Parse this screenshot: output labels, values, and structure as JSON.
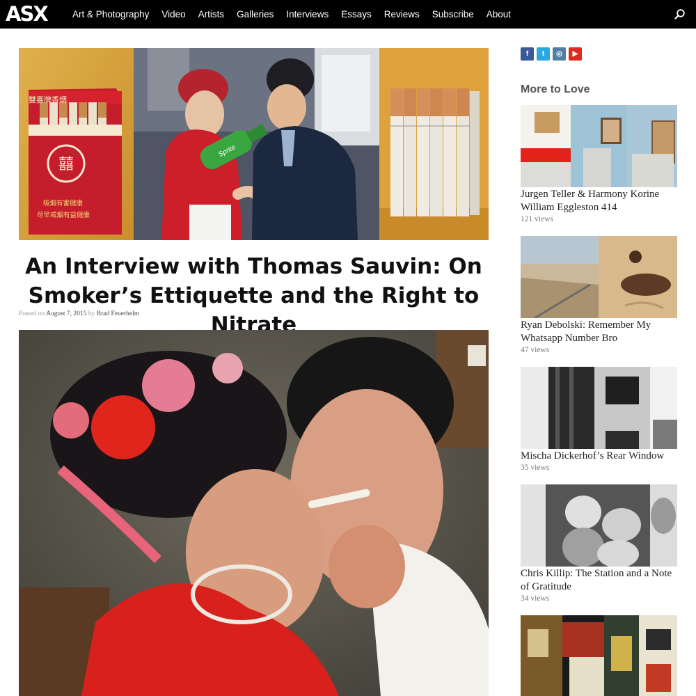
{
  "site": {
    "logo": "ASX",
    "nav": [
      "Art & Photography",
      "Video",
      "Artists",
      "Galleries",
      "Interviews",
      "Essays",
      "Reviews",
      "Subscribe",
      "About"
    ],
    "search_icon": "search-icon"
  },
  "colors": {
    "topbar": "#000000",
    "facebook": "#3b5998",
    "twitter": "#2aa9e0",
    "instagram": "#517fa4",
    "youtube": "#e02a20"
  },
  "article": {
    "title": "An Interview with Thomas Sauvin: On Smoker’s Ettiquette and the Right to Nitrate",
    "posted_on": "Posted on",
    "date": "August 7, 2015",
    "by": "by",
    "author": "Brad Feuerhelm",
    "hero_cigarette_text": "雙喜牌香烟",
    "hero_warning_1": "吸烟有害健康",
    "hero_warning_2": "尽早戒烟有益健康",
    "hero_bottle_label": "Sprite"
  },
  "sidebar": {
    "social": [
      {
        "icon": "facebook-icon",
        "glyph": "f"
      },
      {
        "icon": "twitter-icon",
        "glyph": "t"
      },
      {
        "icon": "instagram-icon",
        "glyph": "◎"
      },
      {
        "icon": "youtube-icon",
        "glyph": "▶"
      }
    ],
    "section_title": "More to Love",
    "cards": [
      {
        "title": "Jurgen Teller & Harmony Korine William Eggleston 414",
        "views": "121 views"
      },
      {
        "title": "Ryan Debolski: Remember My Whatsapp Number Bro",
        "views": "47 views"
      },
      {
        "title": "Mischa Dickerhof’s Rear Window",
        "views": "35 views"
      },
      {
        "title": "Chris Killip: The Station and a Note of Gratitude",
        "views": "34 views"
      },
      {
        "title": "",
        "views": ""
      }
    ]
  }
}
